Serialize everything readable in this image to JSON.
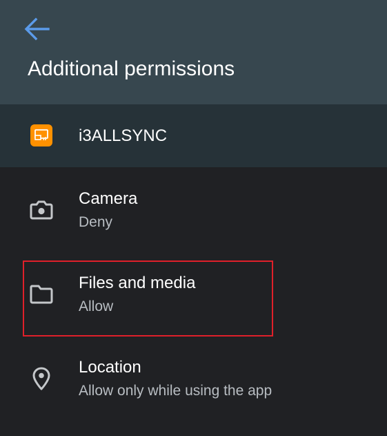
{
  "appbar": {
    "title": "Additional permissions",
    "back_icon": "arrow-back-icon",
    "accent_color": "#5b9bea",
    "background": "#37474f"
  },
  "app": {
    "name": "i3ALLSYNC",
    "icon": "screen-mirror-icon",
    "icon_color": "#ff9100"
  },
  "permissions": [
    {
      "title": "Camera",
      "status": "Deny",
      "icon": "camera-icon"
    },
    {
      "title": "Files and media",
      "status": "Allow",
      "icon": "folder-icon",
      "highlighted": true
    },
    {
      "title": "Location",
      "status": "Allow only while using the app",
      "icon": "location-pin-icon"
    }
  ],
  "highlight_color": "#e0202a"
}
